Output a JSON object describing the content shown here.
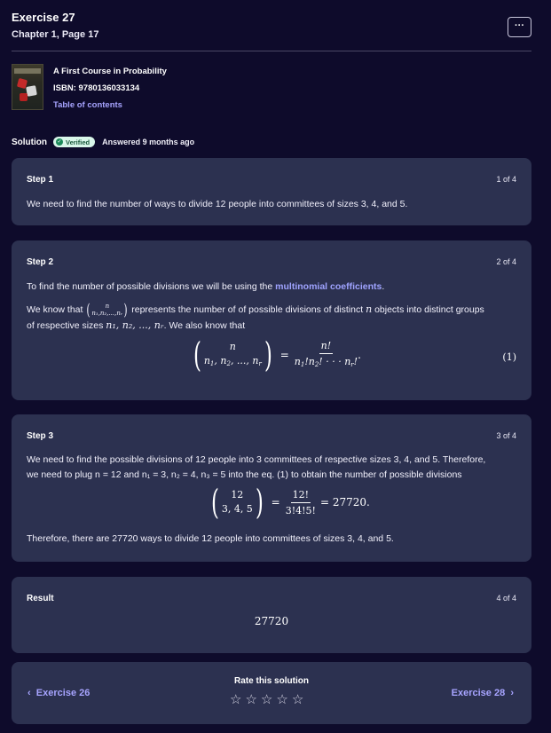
{
  "header": {
    "title": "Exercise 27",
    "subtitle": "Chapter 1, Page 17",
    "more_label": "···"
  },
  "book": {
    "title": "A First Course in Probability",
    "isbn": "ISBN: 9780136033134",
    "toc_label": "Table of contents"
  },
  "solution": {
    "label": "Solution",
    "verified": "Verified",
    "answered": "Answered 9 months ago"
  },
  "steps": [
    {
      "title": "Step 1",
      "count": "1 of 4",
      "text": "We need to find the number of ways to divide 12 people into committees of sizes 3, 4, and 5."
    },
    {
      "title": "Step 2",
      "count": "2 of 4",
      "line1_pre": "To find the number of possible divisions we will be using the ",
      "line1_link": "multinomial coefficients",
      "line1_post": ".",
      "line2_pre": "We know that",
      "line2_post": "represents the number of of possible divisions of distinct",
      "line2_var": "n",
      "line2_end": "objects into distinct groups",
      "line3": "of respective sizes",
      "line3_vars": "n₁, n₂, ..., nᵣ",
      "line3_end": ". We also know that",
      "eq_label": "(1)"
    },
    {
      "title": "Step 3",
      "count": "3 of 4",
      "line1": "We need to find the possible divisions of 12 people into 3 committees of respective sizes 3, 4, and 5. Therefore,",
      "line2": "we need to plug n = 12 and n₁ = 3, n₂ = 4, n₃ = 5 into the eq. (1) to obtain the number of possible divisions",
      "eq_top": "12",
      "eq_bottom": "3, 4, 5",
      "eq_frac_num": "12!",
      "eq_frac_den": "3!4!5!",
      "eq_result": "= 27720.",
      "line3": "Therefore, there are 27720 ways to divide 12 people into committees of sizes 3, 4, and 5."
    },
    {
      "title": "Result",
      "count": "4 of 4",
      "value": "27720"
    }
  ],
  "footer": {
    "prev_label": "Exercise 26",
    "next_label": "Exercise 28",
    "rate_title": "Rate this solution",
    "stars": 0,
    "max_stars": 5
  },
  "colors": {
    "background": "#0e0b2b",
    "card": "#2c3150",
    "accent": "#a7a4ff",
    "verified_bg": "#d9f7ea"
  }
}
